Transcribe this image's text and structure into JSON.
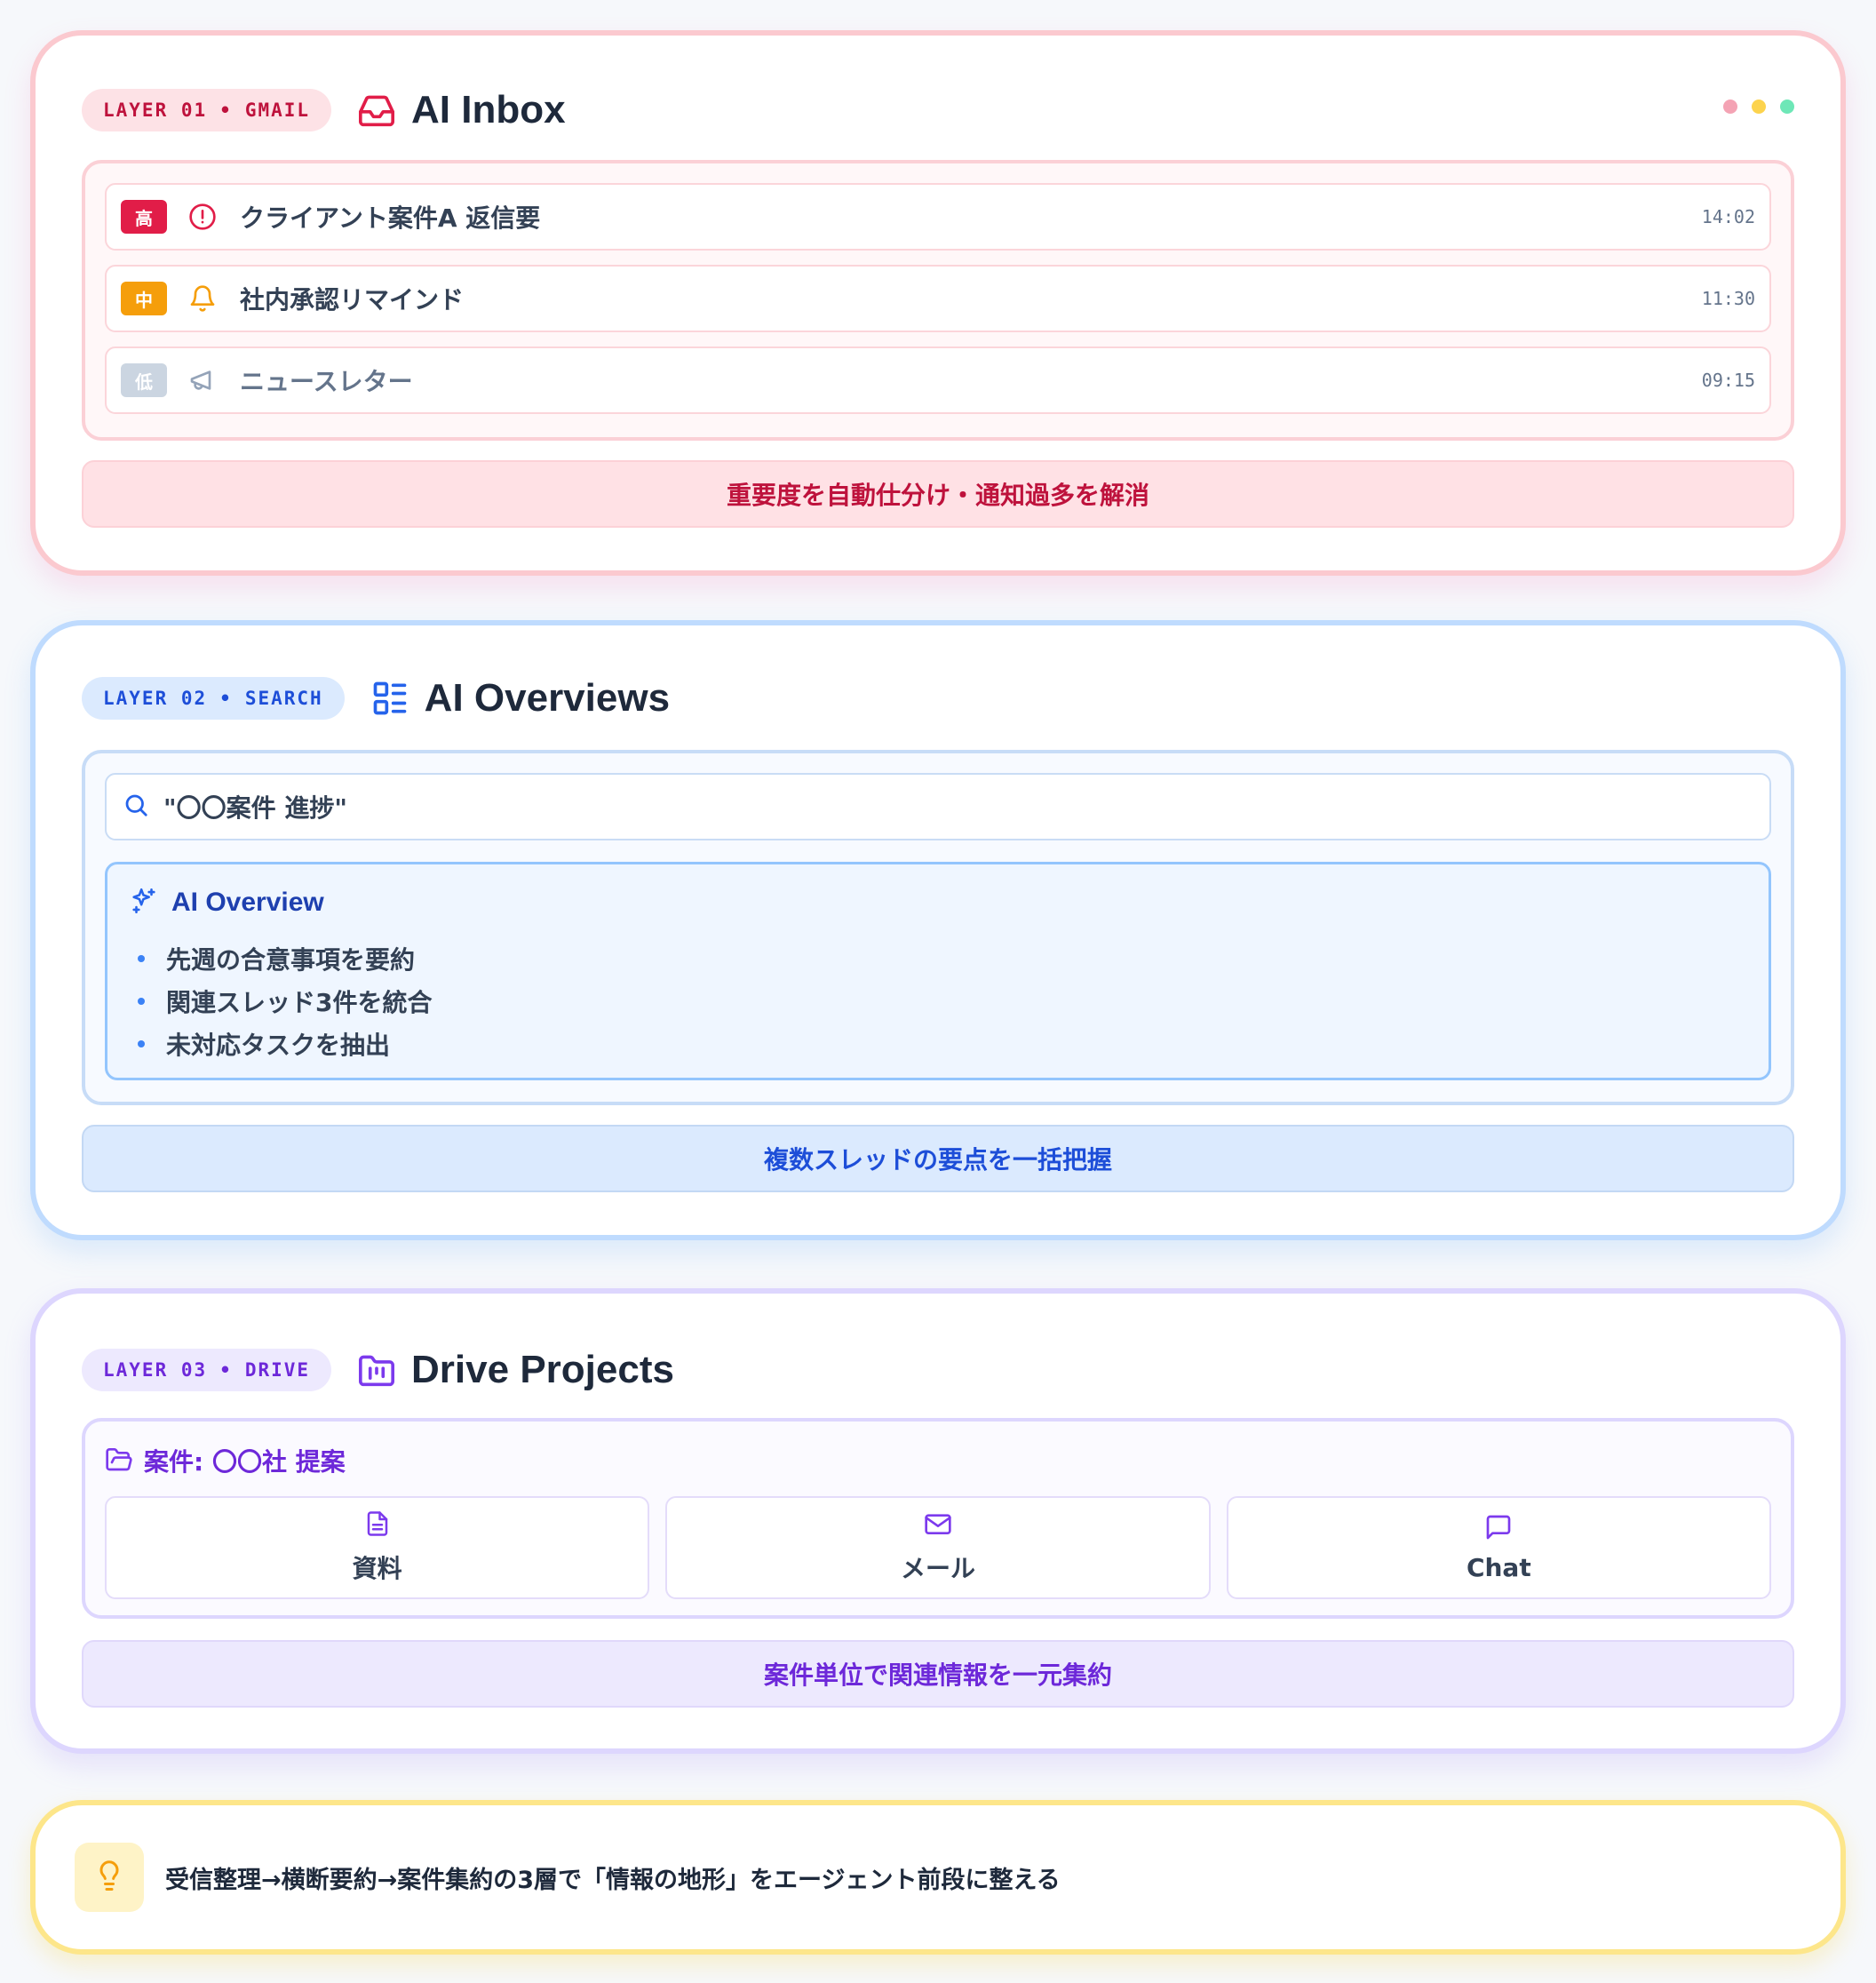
{
  "layer1": {
    "badge_layer": "LAYER 01",
    "badge_service": "GMAIL",
    "icon": "inbox-icon",
    "title": "AI Inbox",
    "window_dots": [
      "#f4a3b4",
      "#fcd34d",
      "#6ee7b7"
    ],
    "emails": [
      {
        "priority": "高",
        "priority_color": "#e11d48",
        "icon": "alert-circle-icon",
        "subject": "クライアント案件A 返信要",
        "time": "14:02"
      },
      {
        "priority": "中",
        "priority_color": "#f59e0b",
        "icon": "bell-icon",
        "subject": "社内承認リマインド",
        "time": "11:30"
      },
      {
        "priority": "低",
        "priority_color": "#cbd5e1",
        "icon": "megaphone-icon",
        "subject": "ニュースレター",
        "time": "09:15"
      }
    ],
    "footer": "重要度を自動仕分け・通知過多を解消"
  },
  "layer2": {
    "badge_layer": "LAYER 02",
    "badge_service": "SEARCH",
    "icon": "list-layout-icon",
    "title": "AI Overviews",
    "search_query": "\"〇〇案件 進捗\"",
    "overview_title": "AI Overview",
    "overview_items": [
      "先週の合意事項を要約",
      "関連スレッド3件を統合",
      "未対応タスクを抽出"
    ],
    "footer": "複数スレッドの要点を一括把握"
  },
  "layer3": {
    "badge_layer": "LAYER 03",
    "badge_service": "DRIVE",
    "icon": "folder-kanban-icon",
    "title": "Drive Projects",
    "project_title": "案件: 〇〇社 提案",
    "tiles": [
      {
        "icon": "document-icon",
        "label": "資料"
      },
      {
        "icon": "mail-icon",
        "label": "メール"
      },
      {
        "icon": "chat-icon",
        "label": "Chat"
      }
    ],
    "footer": "案件単位で関連情報を一元集約"
  },
  "summary": {
    "icon": "lightbulb-icon",
    "text": "受信整理→横断要約→案件集約の3層で「情報の地形」をエージェント前段に整える"
  },
  "colors": {
    "rose": "#be123c",
    "blue": "#1d4ed8",
    "violet": "#6d28d9",
    "amber": "#f59e0b"
  }
}
